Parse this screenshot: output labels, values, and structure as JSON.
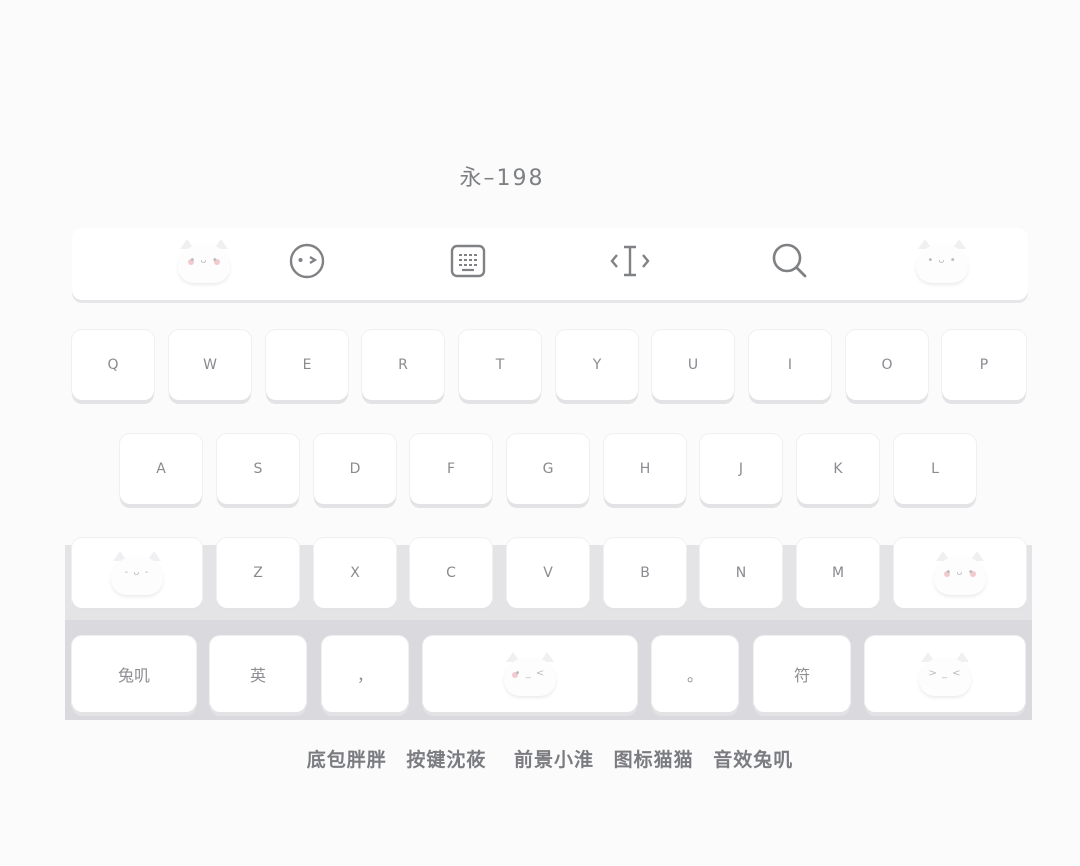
{
  "title": "永–198",
  "toolbar": {
    "items": [
      {
        "name": "cat-mascot-left-icon",
        "interactable": false
      },
      {
        "name": "emoji-face-icon",
        "interactable": true
      },
      {
        "name": "keyboard-icon",
        "interactable": true
      },
      {
        "name": "text-cursor-icon",
        "interactable": true
      },
      {
        "name": "search-icon",
        "interactable": true
      },
      {
        "name": "cat-mascot-right-icon",
        "interactable": false
      }
    ]
  },
  "rows": {
    "row1": [
      "Q",
      "W",
      "E",
      "R",
      "T",
      "Y",
      "U",
      "I",
      "O",
      "P"
    ],
    "row2": [
      "A",
      "S",
      "D",
      "F",
      "G",
      "H",
      "J",
      "K",
      "L"
    ],
    "row3": [
      "Z",
      "X",
      "C",
      "V",
      "B",
      "N",
      "M"
    ]
  },
  "bottom_row": {
    "lang_label": "兔叽",
    "eng_label": "英",
    "comma_label": "，",
    "period_label": "。",
    "symbol_label": "符"
  },
  "footer": {
    "items": [
      "底包胖胖",
      "按键沈莜",
      "前景小淮",
      "图标猫猫",
      "音效兔叽"
    ]
  },
  "colors": {
    "background": "#fbfbfc",
    "key": "#ffffff",
    "key_text": "#8a8b8f",
    "keyboard_bg": "#e4e4e7"
  }
}
